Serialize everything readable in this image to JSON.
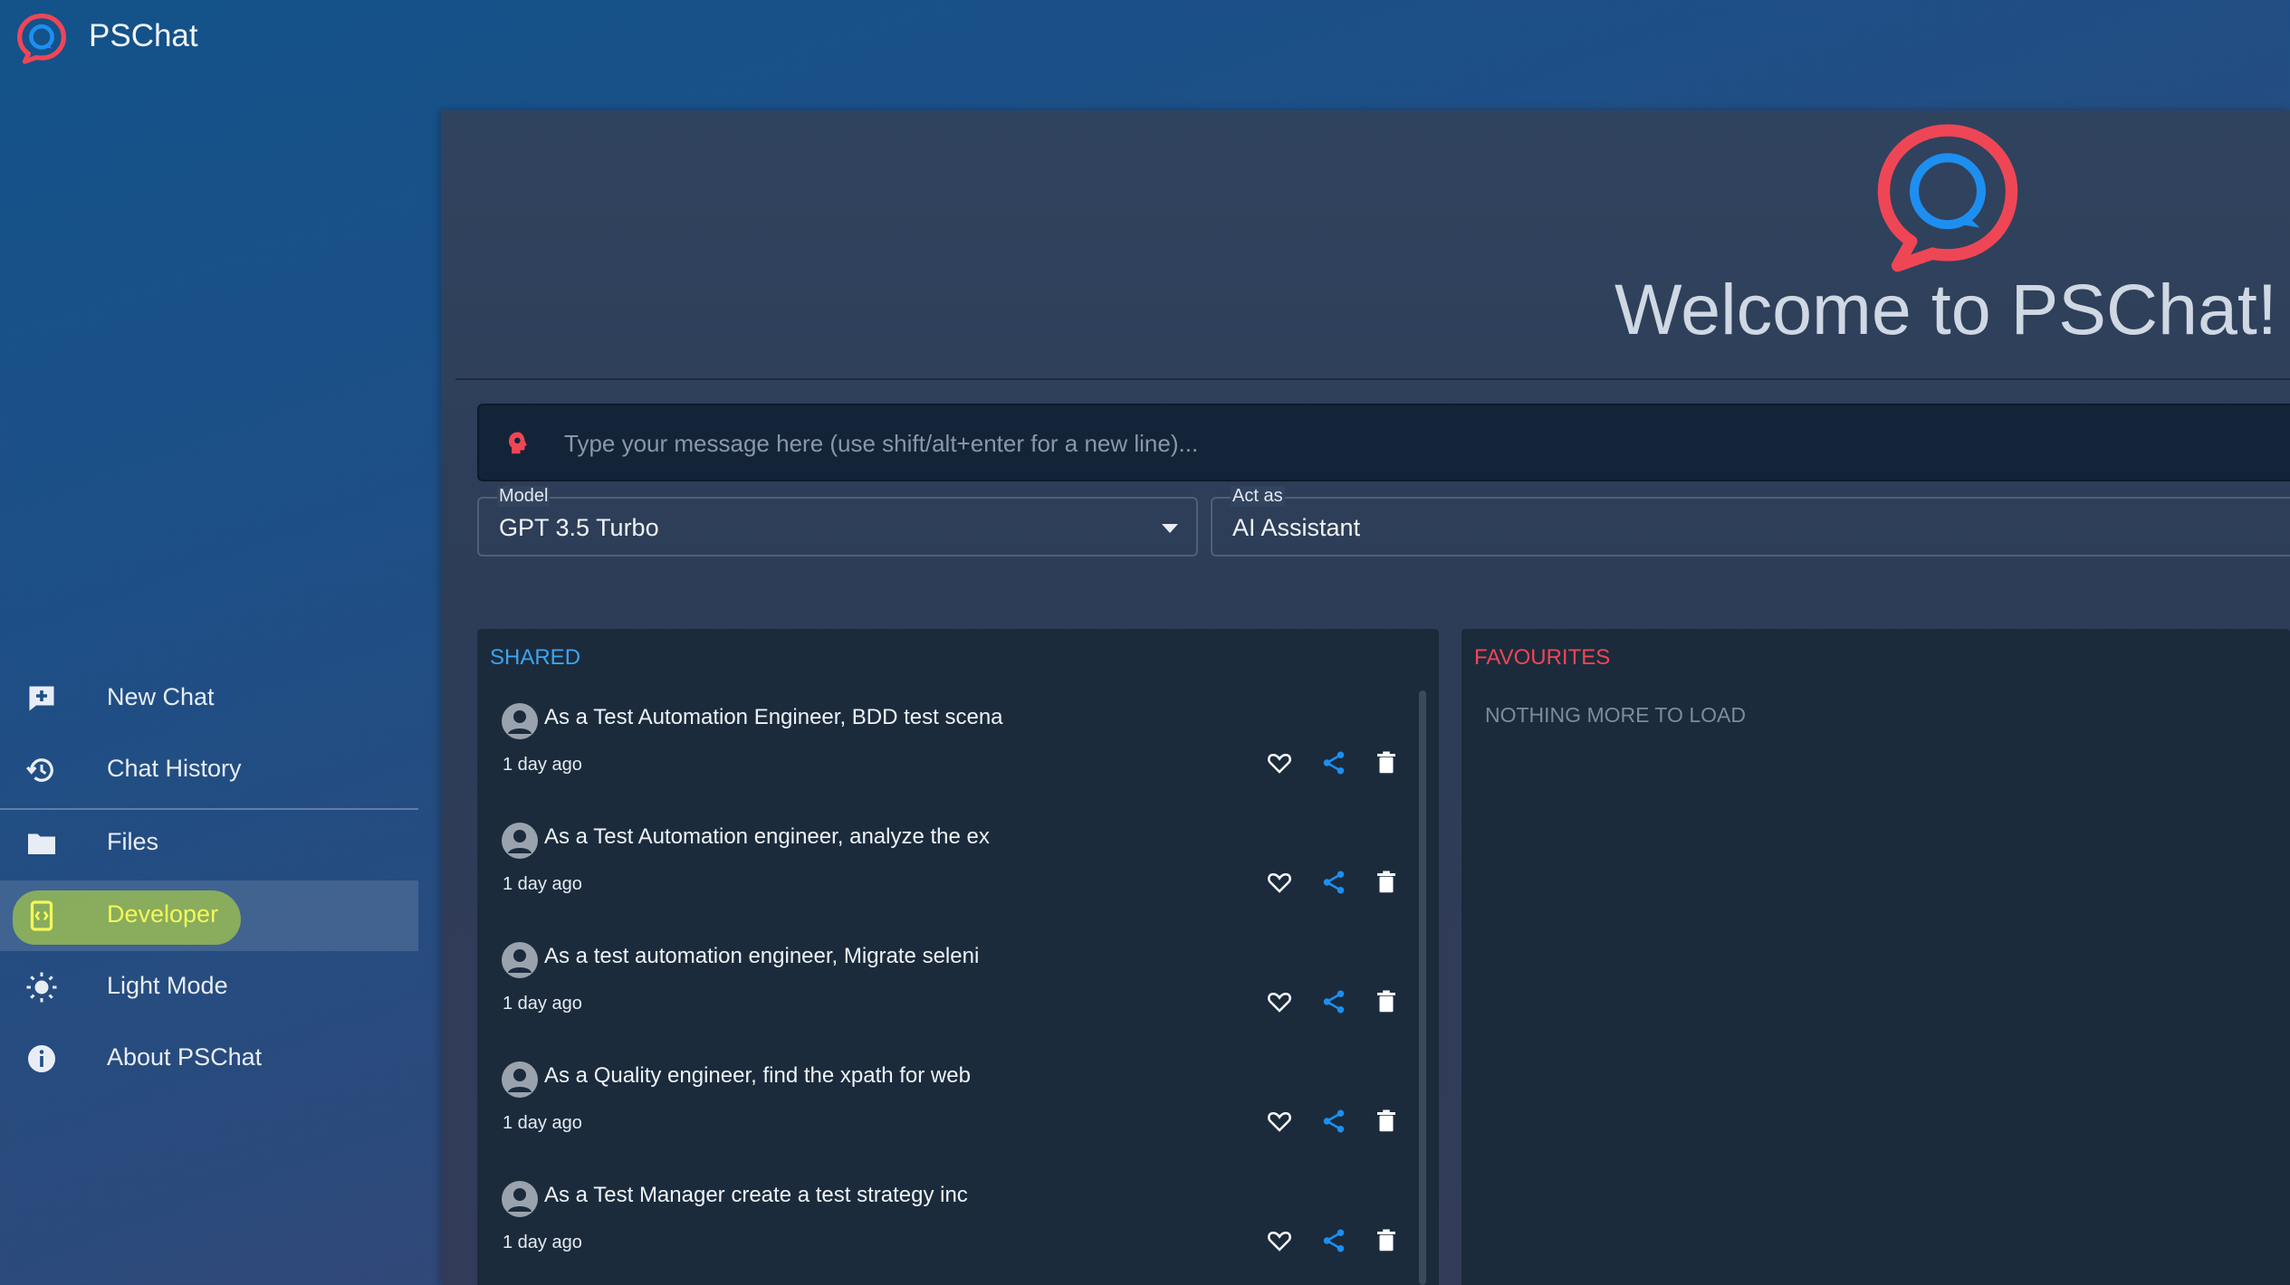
{
  "app": {
    "title": "PSChat",
    "logo_icon": "chat-bubble-logo-icon"
  },
  "colors": {
    "accent_red": "#ef4656",
    "accent_blue": "#1d8ff0",
    "highlight": "#c8e619",
    "active_label": "#f4f75a"
  },
  "sidebar": {
    "items": [
      {
        "label": "New Chat",
        "icon": "add-chat-icon"
      },
      {
        "label": "Chat History",
        "icon": "history-icon"
      },
      {
        "label": "Files",
        "icon": "folder-icon"
      },
      {
        "label": "Developer",
        "icon": "developer-icon",
        "active": true
      },
      {
        "label": "Light Mode",
        "icon": "sun-icon"
      },
      {
        "label": "About PSChat",
        "icon": "info-icon"
      }
    ]
  },
  "main": {
    "welcome": "Welcome to PSChat!",
    "message": {
      "placeholder": "Type your message here (use shift/alt+enter for a new line)...",
      "value": ""
    },
    "model": {
      "label": "Model",
      "value": "GPT 3.5 Turbo"
    },
    "act_as": {
      "label": "Act as",
      "value": "AI Assistant"
    }
  },
  "shared": {
    "title": "SHARED",
    "items": [
      {
        "title": "As a Test Automation Engineer, BDD test scena",
        "time": "1 day ago"
      },
      {
        "title": "As a Test Automation engineer, analyze the ex",
        "time": "1 day ago"
      },
      {
        "title": "As a test automation engineer, Migrate seleni",
        "time": "1 day ago"
      },
      {
        "title": "As a Quality engineer, find the xpath for web",
        "time": "1 day ago"
      },
      {
        "title": "As a Test Manager create a test strategy inc",
        "time": "1 day ago"
      }
    ]
  },
  "favourites": {
    "title": "FAVOURITES",
    "empty_text": "NOTHING MORE TO LOAD"
  }
}
